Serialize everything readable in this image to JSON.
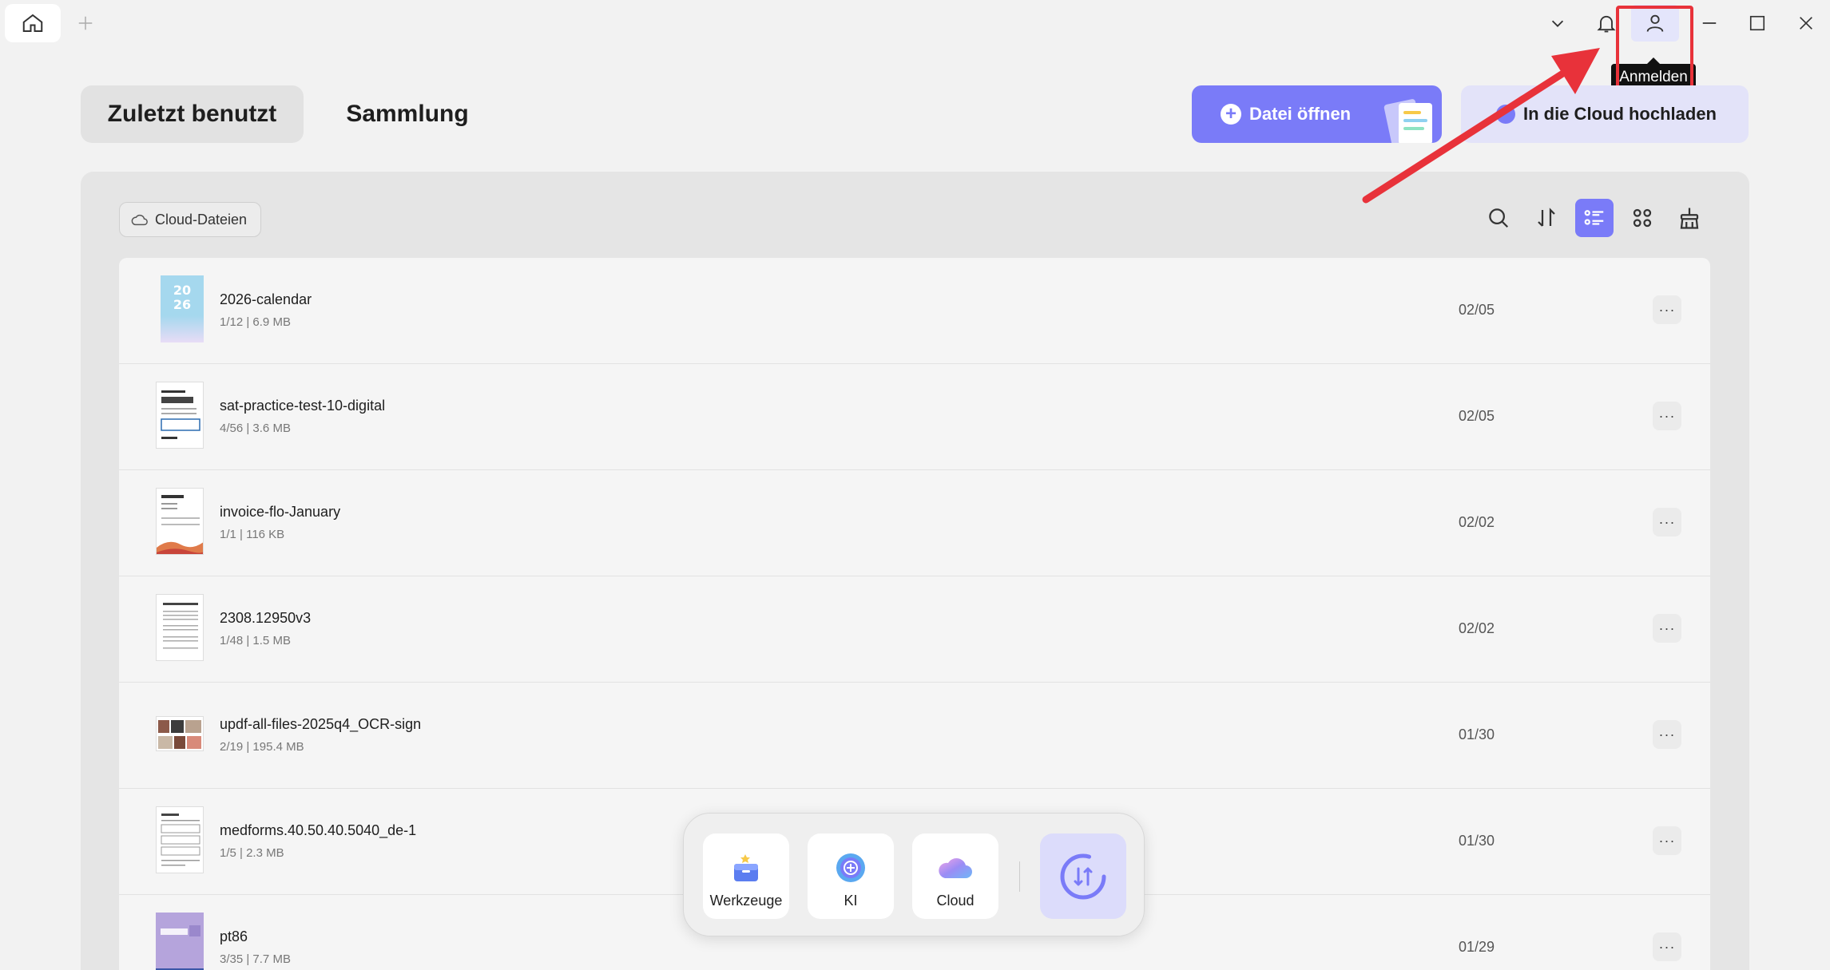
{
  "titlebar": {
    "tooltip": "Anmelden"
  },
  "tabs": {
    "recent": "Zuletzt benutzt",
    "collection": "Sammlung"
  },
  "actions": {
    "open_file": "Datei öffnen",
    "upload_cloud": "In die Cloud hochladen"
  },
  "panel": {
    "cloud_files": "Cloud-Dateien"
  },
  "files": [
    {
      "name": "2026-calendar",
      "meta": "1/12 | 6.9 MB",
      "date": "02/05"
    },
    {
      "name": "sat-practice-test-10-digital",
      "meta": "4/56 | 3.6 MB",
      "date": "02/05"
    },
    {
      "name": "invoice-flo-January",
      "meta": "1/1 | 116 KB",
      "date": "02/02"
    },
    {
      "name": "2308.12950v3",
      "meta": "1/48 | 1.5 MB",
      "date": "02/02"
    },
    {
      "name": "updf-all-files-2025q4_OCR-sign",
      "meta": "2/19 | 195.4 MB",
      "date": "01/30"
    },
    {
      "name": "medforms.40.50.40.5040_de-1",
      "meta": "1/5 | 2.3 MB",
      "date": "01/30"
    },
    {
      "name": "pt86",
      "meta": "3/35 | 7.7 MB",
      "date": "01/29"
    }
  ],
  "dock": {
    "tools": "Werkzeuge",
    "ai": "KI",
    "cloud": "Cloud"
  },
  "colors": {
    "accent": "#7a7bf8",
    "annotation": "#e8323a"
  }
}
